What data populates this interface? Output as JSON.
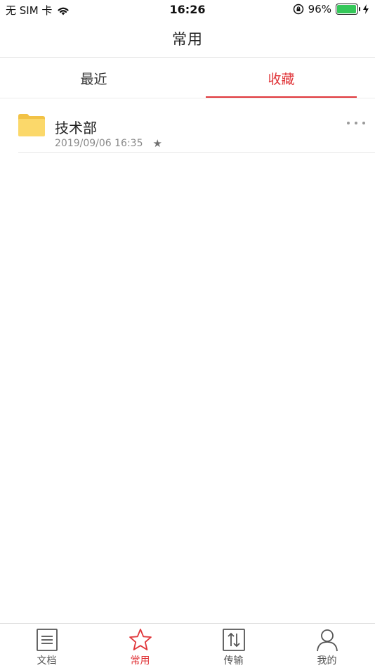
{
  "status_bar": {
    "carrier": "无 SIM 卡",
    "time": "16:26",
    "battery_percent": "96%",
    "battery_level": 0.96,
    "battery_color": "#34c759"
  },
  "nav": {
    "title": "常用"
  },
  "tabs": [
    {
      "label": "最近",
      "active": false
    },
    {
      "label": "收藏",
      "active": true
    }
  ],
  "accent_color": "#e0363a",
  "list": [
    {
      "title": "技术部",
      "date": "2019/09/06 16:35",
      "icon": "folder-icon",
      "starred": true
    }
  ],
  "tab_bar": [
    {
      "label": "文档",
      "icon": "document-icon",
      "active": false
    },
    {
      "label": "常用",
      "icon": "star-icon",
      "active": true
    },
    {
      "label": "传输",
      "icon": "transfer-icon",
      "active": false
    },
    {
      "label": "我的",
      "icon": "person-icon",
      "active": false
    }
  ]
}
